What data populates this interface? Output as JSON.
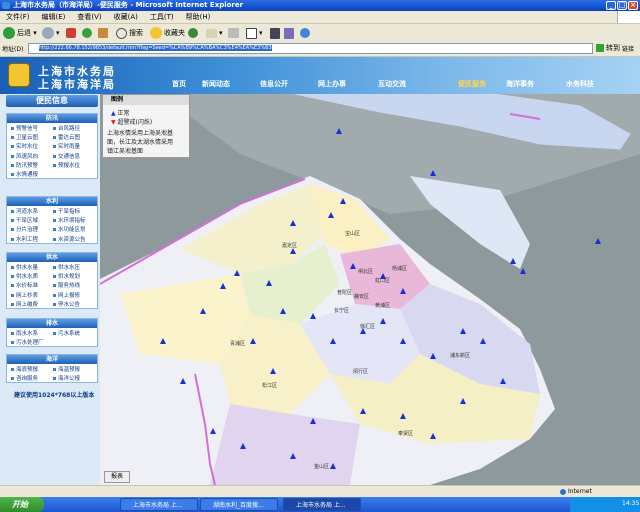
{
  "window": {
    "title": "上海市水务局（市海洋局）-便民服务 - Microsoft Internet Explorer"
  },
  "menu": [
    "文件(F)",
    "编辑(E)",
    "查看(V)",
    "收藏(A)",
    "工具(T)",
    "帮助(H)"
  ],
  "toolbar": {
    "back": "后退",
    "search": "搜索",
    "favorites": "收藏夹"
  },
  "address": {
    "label": "地址(D)",
    "url": "http://222.66.78.152/9853/default.htm?flag=Seed=%CA%B9%CA%BA%C3%E4%EA%E3%B3",
    "go": "转到",
    "links": "链接"
  },
  "site": {
    "name_line1": "上海市水务局",
    "name_line2": "上海市海洋局"
  },
  "nav": [
    "首页",
    "新闻动态",
    "信息公开",
    "网上办事",
    "互动交流",
    "便民服务",
    "海洋事务",
    "水务科技"
  ],
  "nav_active": 5,
  "sidebar": {
    "title": "便民信息",
    "sections": [
      {
        "title": "防汛",
        "items": [
          "预警信号",
          "台风路径",
          "卫星云图",
          "雷达云图",
          "实时水位",
          "实时雨量",
          "风速风向",
          "交通信息",
          "防汛预警",
          "预报水位",
          "水情通报"
        ]
      },
      {
        "title": "水利",
        "items": [
          "河道水系",
          "干旱指标",
          "干旱区域",
          "水环境指标",
          "分片治理",
          "水功能区划",
          "水利工程",
          "水资源公告"
        ]
      },
      {
        "title": "供水",
        "items": [
          "供水水量",
          "供水水压",
          "供水水质",
          "供水规划",
          "水价标准",
          "服务热线",
          "网上抄表",
          "网上报修",
          "网上缴费",
          "停水公告"
        ]
      },
      {
        "title": "排水",
        "items": [
          "雨水水系",
          "污水系统",
          "污水处理厂"
        ]
      },
      {
        "title": "海洋",
        "items": [
          "海浪预报",
          "海温预报",
          "咨询服务",
          "海洋公报"
        ]
      }
    ],
    "footer_note": "建议使用1024*768以上版本"
  },
  "map": {
    "legend_title": "图例",
    "legend_items": [
      {
        "label": "正常",
        "symbol": "blue-triangle"
      },
      {
        "label": "超警戒(闪烁)",
        "symbol": "red-triangle"
      },
      {
        "label": "上海水情采用上海吴淞基",
        "symbol": ""
      },
      {
        "label": "面，长江及太湖水情采用",
        "symbol": ""
      },
      {
        "label": "镇江吴淞基面",
        "symbol": ""
      }
    ],
    "report_button": "报表",
    "district_labels": [
      "宝山区",
      "嘉定区",
      "闸北区",
      "虹口区",
      "杨浦区",
      "普陀区",
      "静安区",
      "黄浦区",
      "长宁区",
      "徐汇区",
      "浦东新区",
      "闵行区",
      "青浦区",
      "松江区",
      "奉贤区",
      "金山区"
    ]
  },
  "statusbar": {
    "zone": "Internet"
  },
  "taskbar": {
    "start": "开始",
    "tasks": [
      "上海市水务局 上...",
      "湖南水利_百度搜...",
      "上海市水务局 上..."
    ],
    "active_task": 2,
    "clock": "14:35"
  }
}
